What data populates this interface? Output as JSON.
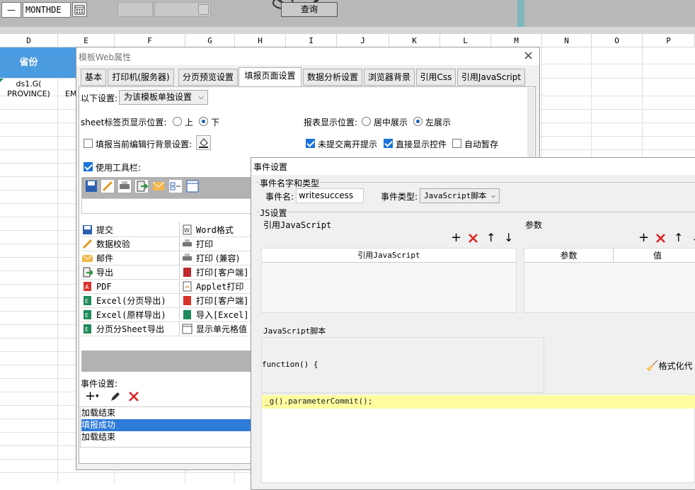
{
  "toolbar": {
    "dash": "—",
    "month_field": "MONTHDE",
    "query_button": "查询"
  },
  "spreadsheet": {
    "columns": [
      "D",
      "E",
      "F",
      "G",
      "H",
      "I",
      "J",
      "K",
      "L",
      "M",
      "N",
      "O",
      "P"
    ],
    "header_cell": "省份",
    "formula_cell_1": "ds1.G(",
    "formula_cell_2": "PROVINCE)",
    "partial_cell": "EM"
  },
  "web_dialog": {
    "title": "模板Web属性",
    "tabs": [
      "基本",
      "打印机(服务器)",
      "分页预览设置",
      "填报页面设置",
      "数据分析设置",
      "浏览器背景",
      "引用Css",
      "引用JavaScript"
    ],
    "settings_label": "以下设置:",
    "settings_value": "为该模板单独设置",
    "sheet_tab_label": "sheet标签页显示位置:",
    "sheet_tab_top": "上",
    "sheet_tab_bottom": "下",
    "report_pos_label": "报表显示位置:",
    "report_pos_center": "居中展示",
    "report_pos_left": "左展示",
    "edit_row_bg": "填报当前编辑行背景设置:",
    "unsubmitted_leave": "未提交离开提示",
    "direct_show_ctrl": "直接显示控件",
    "auto_save": "自动暂存",
    "use_toolbar": "使用工具栏:",
    "toolbar_items_left": [
      "提交",
      "数据校验",
      "邮件",
      "导出",
      "PDF",
      "Excel(分页导出)",
      "Excel(原样导出)",
      "分页分Sheet导出"
    ],
    "toolbar_items_right": [
      "Word格式",
      "打印",
      "打印 (兼容)",
      "打印[客户端]",
      "Applet打印",
      "打印[客户端]",
      "导入[Excel]",
      "显示单元格值"
    ],
    "event_settings_label": "事件设置:",
    "events": [
      "加载结束",
      "填报成功",
      "加载结束"
    ]
  },
  "event_dialog": {
    "title": "事件设置",
    "group_name_type": "事件名字和类型",
    "event_name_label": "事件名:",
    "event_name_value": "writesuccess",
    "event_type_label": "事件类型:",
    "event_type_value": "JavaScript脚本",
    "js_settings": "JS设置",
    "ref_js_label": "引用JavaScript",
    "params_label": "参数",
    "table_ref_js_header": "引用JavaScript",
    "table_param_header": "参数",
    "table_value_header": "值",
    "js_script_label": "JavaScript脚本",
    "function_text": "function() {",
    "format_code": "格式化代",
    "code_line": "_g().parameterCommit();"
  }
}
